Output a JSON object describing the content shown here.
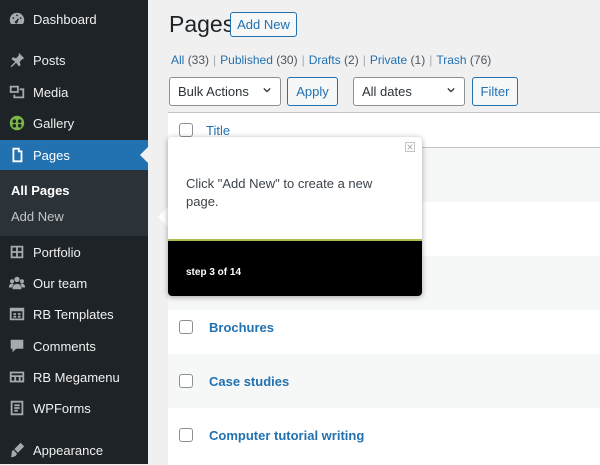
{
  "sidebar": {
    "items": [
      {
        "label": "Dashboard",
        "icon": "dashboard-icon"
      },
      {
        "label": "Posts",
        "icon": "pin-icon"
      },
      {
        "label": "Media",
        "icon": "media-icon"
      },
      {
        "label": "Gallery",
        "icon": "gallery-icon"
      },
      {
        "label": "Pages",
        "icon": "pages-icon",
        "active": true
      },
      {
        "label": "Portfolio",
        "icon": "portfolio-icon"
      },
      {
        "label": "Our team",
        "icon": "team-icon"
      },
      {
        "label": "RB Templates",
        "icon": "templates-icon"
      },
      {
        "label": "Comments",
        "icon": "comments-icon"
      },
      {
        "label": "RB Megamenu",
        "icon": "megamenu-icon"
      },
      {
        "label": "WPForms",
        "icon": "forms-icon"
      },
      {
        "label": "Appearance",
        "icon": "appearance-icon"
      }
    ],
    "submenu": [
      {
        "label": "All Pages",
        "current": true
      },
      {
        "label": "Add New",
        "current": false
      }
    ]
  },
  "header": {
    "title": "Pages",
    "add_new_label": "Add New"
  },
  "filters": {
    "all": {
      "label": "All",
      "count": "(33)"
    },
    "published": {
      "label": "Published",
      "count": "(30)"
    },
    "drafts": {
      "label": "Drafts",
      "count": "(2)"
    },
    "private": {
      "label": "Private",
      "count": "(1)"
    },
    "trash": {
      "label": "Trash",
      "count": "(76)"
    }
  },
  "toolbar": {
    "bulk_actions": "Bulk Actions",
    "apply": "Apply",
    "dates": "All dates",
    "filter": "Filter"
  },
  "table": {
    "column_title": "Title",
    "rows": [
      "Brochures",
      "Case studies",
      "Computer tutorial writing"
    ]
  },
  "tooltip": {
    "message": "Click \"Add New\" to create a new page.",
    "step": "step 3 of 14",
    "accent_color": "#a7c04a"
  },
  "colors": {
    "sidebar_bg": "#1d2327",
    "accent": "#2271b1",
    "submenu_bg": "#2c3338"
  }
}
